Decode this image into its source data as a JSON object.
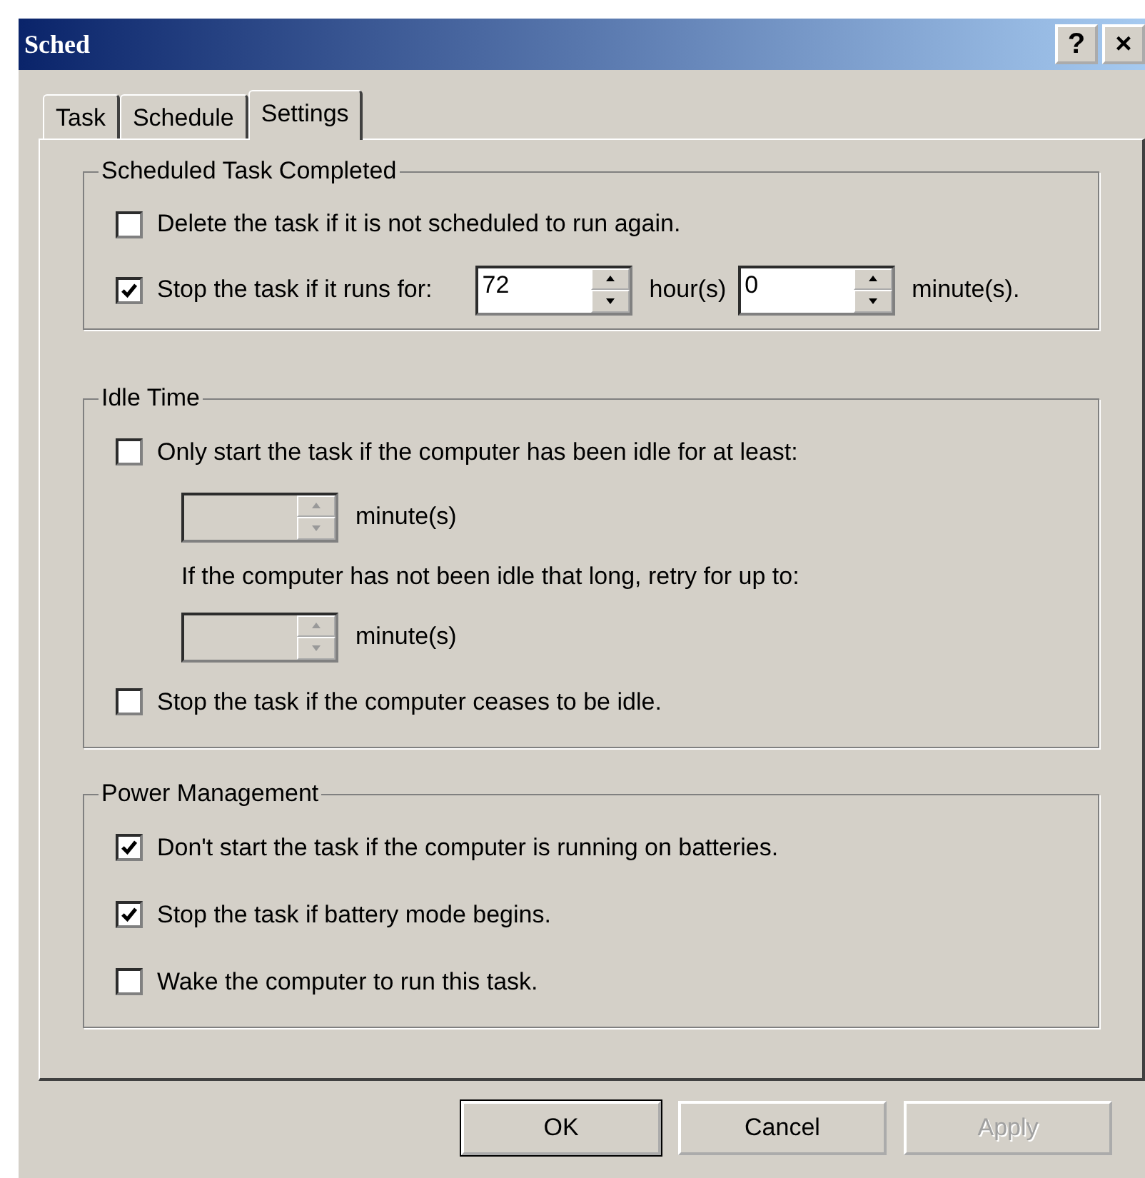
{
  "window": {
    "title": "Sched",
    "help_button": "?",
    "close_button": "×"
  },
  "tabs": [
    {
      "label": "Task",
      "selected": false
    },
    {
      "label": "Schedule",
      "selected": false
    },
    {
      "label": "Settings",
      "selected": true
    }
  ],
  "groups": [
    {
      "title": "Scheduled Task Completed",
      "rows": [
        {
          "kind": "checkbox",
          "label": "Delete the task if it is not scheduled to run again.",
          "checked": false
        },
        {
          "kind": "checkbox",
          "label": "Stop the task if it runs for:",
          "checked": true,
          "spinners": [
            {
              "value": "72",
              "unit": "hour(s)",
              "disabled": false
            },
            {
              "value": "0",
              "unit": "minute(s).",
              "disabled": false
            }
          ]
        }
      ]
    },
    {
      "title": "Idle Time",
      "rows": [
        {
          "kind": "checkbox",
          "label": "Only start the task if the computer has been idle for at least:",
          "checked": false
        },
        {
          "kind": "spinner",
          "spinners": [
            {
              "unit": "minute(s)",
              "disabled": true
            }
          ]
        },
        {
          "kind": "note",
          "label": "If the computer has not been idle that long, retry for up to:"
        },
        {
          "kind": "spinner",
          "spinners": [
            {
              "unit": "minute(s)",
              "disabled": true
            }
          ]
        },
        {
          "kind": "checkbox",
          "label": "Stop the task if the computer ceases to be idle.",
          "checked": false
        }
      ]
    },
    {
      "title": "Power Management",
      "rows": [
        {
          "kind": "checkbox",
          "label": "Don't start the task if the computer is running on batteries.",
          "checked": true
        },
        {
          "kind": "checkbox",
          "label": "Stop the task if battery mode begins.",
          "checked": true
        },
        {
          "kind": "checkbox",
          "label": "Wake the computer to run this task.",
          "checked": false
        }
      ]
    }
  ],
  "buttons": [
    {
      "label": "OK",
      "default": true,
      "disabled": false
    },
    {
      "label": "Cancel",
      "default": false,
      "disabled": false
    },
    {
      "label": "Apply",
      "default": false,
      "disabled": true
    }
  ]
}
